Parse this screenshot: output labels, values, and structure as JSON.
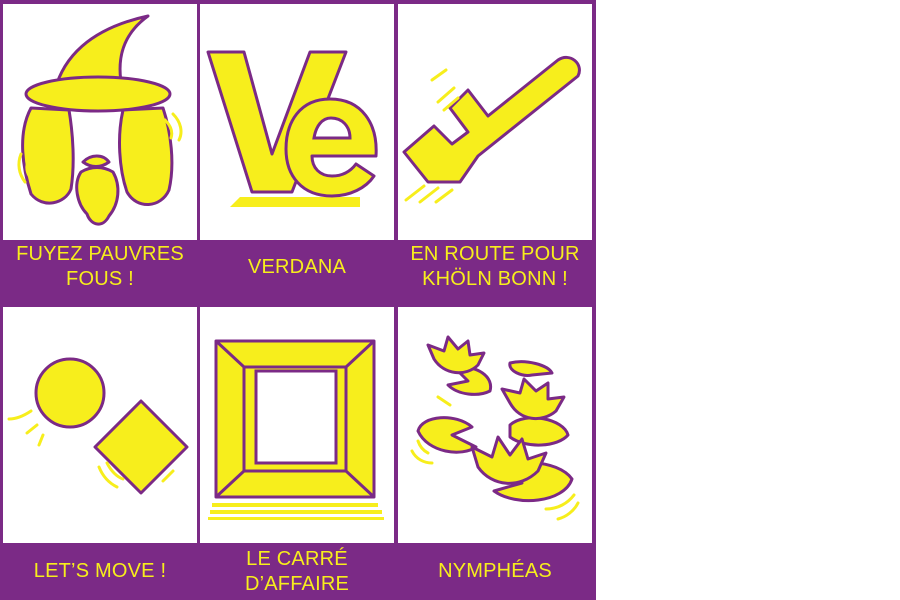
{
  "palette": {
    "purple": "#7b2a86",
    "yellow": "#f7ee1c",
    "white": "#ffffff"
  },
  "cards": [
    {
      "label": "FUYEZ PAUVRES\nFOUS !",
      "icon": "wizard-icon"
    },
    {
      "label": "VERDANA",
      "icon": "ve-letters-icon"
    },
    {
      "label": "EN ROUTE POUR\nKHÖLN BONN !",
      "icon": "tilted-y-icon"
    },
    {
      "label": "LET’S MOVE !",
      "icon": "circle-diamond-icon"
    },
    {
      "label": "LE CARRÉ\nD’AFFAIRE",
      "icon": "square-frame-icon"
    },
    {
      "label": "NYMPHÉAS",
      "icon": "water-lilies-icon"
    }
  ]
}
